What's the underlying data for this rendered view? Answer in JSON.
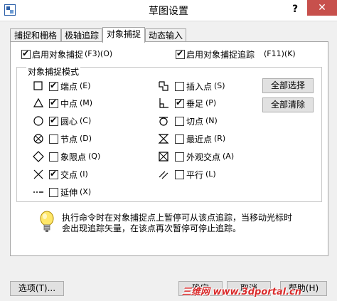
{
  "window": {
    "title": "草图设置",
    "help_label": "?",
    "close_label": "✕"
  },
  "tabs": [
    {
      "label": "捕捉和栅格",
      "active": false
    },
    {
      "label": "极轴追踪",
      "active": false
    },
    {
      "label": "对象捕捉",
      "active": true
    },
    {
      "label": "动态输入",
      "active": false
    }
  ],
  "top_options": {
    "enable_osnap": {
      "label": "启用对象捕捉",
      "shortcut": "(F3)(O)",
      "checked": true
    },
    "enable_tracking": {
      "label": "启用对象捕捉追踪",
      "shortcut": "(F11)(K)",
      "checked": true
    }
  },
  "group": {
    "title": "对象捕捉模式"
  },
  "snap_modes_left": [
    {
      "icon": "square-icon",
      "label": "端点",
      "key": "(E)",
      "checked": true
    },
    {
      "icon": "triangle-icon",
      "label": "中点",
      "key": "(M)",
      "checked": true
    },
    {
      "icon": "circle-icon",
      "label": "圆心",
      "key": "(C)",
      "checked": true
    },
    {
      "icon": "node-icon",
      "label": "节点",
      "key": "(D)",
      "checked": false
    },
    {
      "icon": "diamond-icon",
      "label": "象限点",
      "key": "(Q)",
      "checked": false
    },
    {
      "icon": "cross-icon",
      "label": "交点",
      "key": "(I)",
      "checked": true
    },
    {
      "icon": "extension-icon",
      "label": "延伸",
      "key": "(X)",
      "checked": false
    }
  ],
  "snap_modes_right": [
    {
      "icon": "insertion-icon",
      "label": "插入点",
      "key": "(S)",
      "checked": false
    },
    {
      "icon": "perpendicular-icon",
      "label": "垂足",
      "key": "(P)",
      "checked": true
    },
    {
      "icon": "tangent-icon",
      "label": "切点",
      "key": "(N)",
      "checked": false
    },
    {
      "icon": "nearest-icon",
      "label": "最近点",
      "key": "(R)",
      "checked": false
    },
    {
      "icon": "apparent-intersection-icon",
      "label": "外观交点",
      "key": "(A)",
      "checked": false
    },
    {
      "icon": "parallel-icon",
      "label": "平行",
      "key": "(L)",
      "checked": false
    }
  ],
  "buttons": {
    "select_all": "全部选择",
    "clear_all": "全部清除"
  },
  "tip": {
    "line1": "执行命令时在对象捕捉点上暂停可从该点追踪，当移动光标时",
    "line2": "会出现追踪矢量，在该点再次暂停可停止追踪。"
  },
  "footer": {
    "options": "选项(T)...",
    "ok": "确定",
    "cancel": "取消",
    "help": "帮助(H)"
  },
  "watermark": "三维网 www.3dportal.cn",
  "colors": {
    "close": "#c7504c",
    "accent": "#0078d7",
    "watermark": "#d92b2b"
  }
}
